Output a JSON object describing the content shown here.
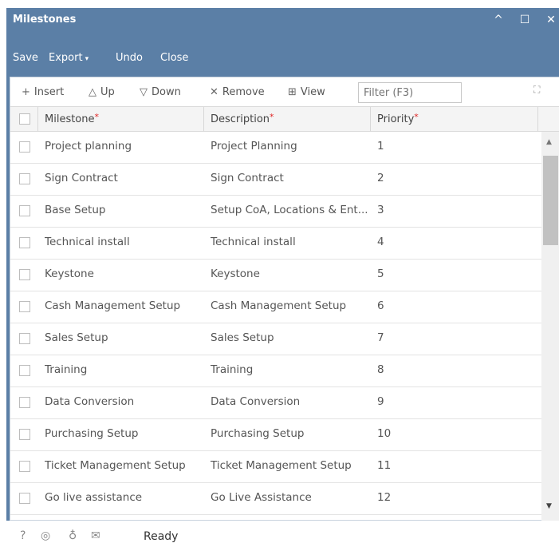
{
  "window": {
    "title": "Milestones",
    "minimize_icon": "^",
    "maximize_icon": "☐",
    "close_icon": "✕"
  },
  "toolbar": {
    "save_label": "Save",
    "export_label": "Export",
    "undo_label": "Undo",
    "close_label": "Close"
  },
  "grid_toolbar": {
    "insert_label": "Insert",
    "up_label": "Up",
    "down_label": "Down",
    "remove_label": "Remove",
    "view_label": "View",
    "filter_placeholder": "Filter (F3)"
  },
  "columns": {
    "milestone": "Milestone",
    "description": "Description",
    "priority": "Priority",
    "required_marker": "*"
  },
  "rows": [
    {
      "milestone": "Project planning",
      "description": "Project Planning",
      "priority": "1"
    },
    {
      "milestone": "Sign Contract",
      "description": "Sign Contract",
      "priority": "2"
    },
    {
      "milestone": "Base Setup",
      "description": "Setup CoA, Locations & Ent...",
      "priority": "3"
    },
    {
      "milestone": "Technical install",
      "description": "Technical install",
      "priority": "4"
    },
    {
      "milestone": "Keystone",
      "description": "Keystone",
      "priority": "5"
    },
    {
      "milestone": "Cash Management Setup",
      "description": "Cash Management Setup",
      "priority": "6"
    },
    {
      "milestone": "Sales Setup",
      "description": "Sales Setup",
      "priority": "7"
    },
    {
      "milestone": "Training",
      "description": "Training",
      "priority": "8"
    },
    {
      "milestone": "Data Conversion",
      "description": "Data Conversion",
      "priority": "9"
    },
    {
      "milestone": "Purchasing Setup",
      "description": "Purchasing Setup",
      "priority": "10"
    },
    {
      "milestone": "Ticket Management Setup",
      "description": "Ticket Management Setup",
      "priority": "11"
    },
    {
      "milestone": "Go live assistance",
      "description": "Go Live Assistance",
      "priority": "12"
    }
  ],
  "status": {
    "text": "Ready"
  },
  "colors": {
    "header_blue": "#5b7fa6",
    "required_red": "#e02424"
  }
}
